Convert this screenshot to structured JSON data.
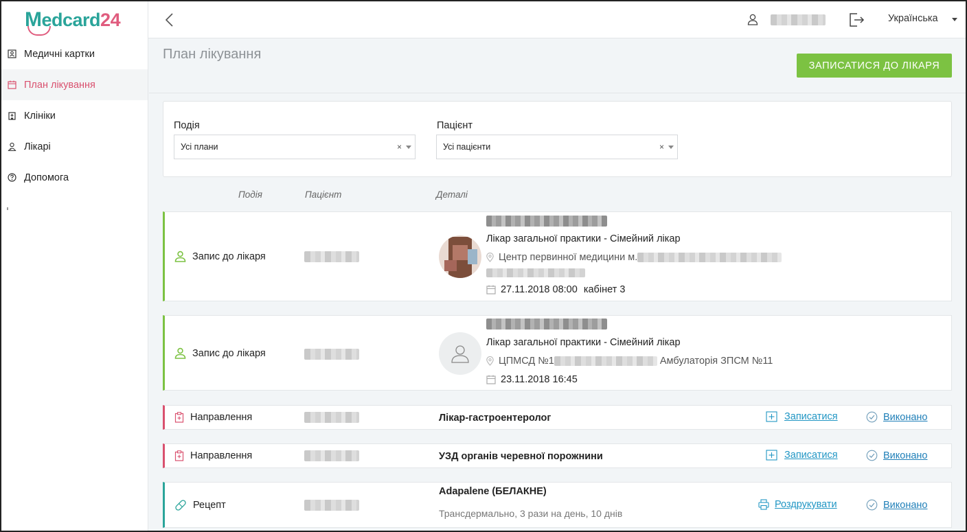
{
  "logo": {
    "m": "M",
    "rest": "edcard",
    "num": "24"
  },
  "sidebar": {
    "items": [
      {
        "label": "Медичні картки",
        "icon": "medical-card-icon"
      },
      {
        "label": "План лікування",
        "icon": "calendar-icon",
        "active": true
      },
      {
        "label": "Клініки",
        "icon": "clinic-icon"
      },
      {
        "label": "Лікарі",
        "icon": "doctor-icon"
      },
      {
        "label": "Допомога",
        "icon": "help-icon"
      }
    ]
  },
  "topbar": {
    "language": "Українська"
  },
  "page": {
    "title": "План лікування",
    "book_button": "ЗАПИСАТИСЯ ДО ЛІКАРЯ"
  },
  "filters": {
    "event": {
      "label": "Подія",
      "value": "Усі плани",
      "clear": "×"
    },
    "patient": {
      "label": "Пацієнт",
      "value": "Усі пацієнти",
      "clear": "×"
    }
  },
  "columns": {
    "event": "Подія",
    "patient": "Пацієнт",
    "details": "Деталі"
  },
  "rows": [
    {
      "event": "Запис до лікаря",
      "specialty": "Лікар загальної практики - Сімейний лікар",
      "address_prefix": "Центр первинної медицини м.",
      "date": "27.11.2018 08:00",
      "room": "кабінет 3"
    },
    {
      "event": "Запис до лікаря",
      "specialty": "Лікар загальної практики - Сімейний лікар",
      "address_prefix": "ЦПМСД №1",
      "address_suffix": "Амбулаторія ЗПСМ №11",
      "date": "23.11.2018 16:45"
    },
    {
      "event": "Направлення",
      "detail": "Лікар-гастроентеролог",
      "action": "Записатися",
      "done": "Виконано"
    },
    {
      "event": "Направлення",
      "detail": "УЗД органів черевної порожнини",
      "action": "Записатися",
      "done": "Виконано"
    },
    {
      "event": "Рецепт",
      "detail": "Adapalene (БЕЛАКНЕ)",
      "sub": "Трансдермально, 3 рази на день, 10 днів",
      "action": "Роздрукувати",
      "done": "Виконано"
    }
  ],
  "colors": {
    "accent_green": "#7cc242",
    "accent_red": "#d9506e",
    "accent_teal": "#2aa49a",
    "link": "#2196c4"
  }
}
